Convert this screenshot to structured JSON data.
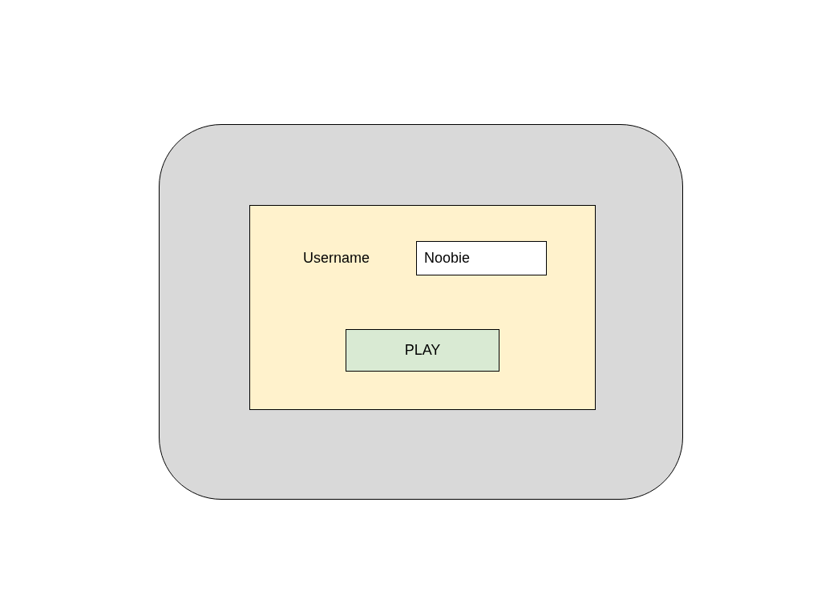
{
  "username": {
    "label": "Username",
    "value": "Noobie"
  },
  "play_button": {
    "label": "PLAY"
  }
}
